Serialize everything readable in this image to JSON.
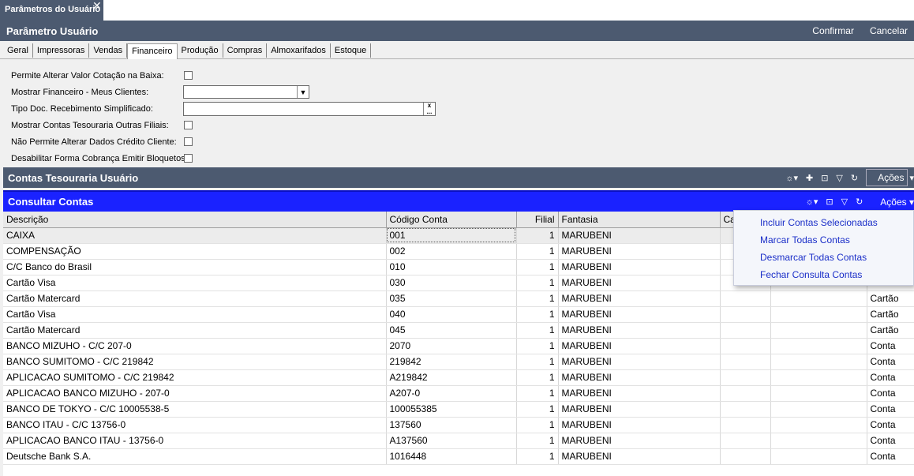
{
  "doc_tab": {
    "title": "Parâmetros do Usuário"
  },
  "header": {
    "title": "Parâmetro Usuário",
    "confirm_label": "Confirmar",
    "cancel_label": "Cancelar"
  },
  "tabs": [
    {
      "label": "Geral"
    },
    {
      "label": "Impressoras"
    },
    {
      "label": "Vendas"
    },
    {
      "label": "Financeiro",
      "active": true
    },
    {
      "label": "Produção"
    },
    {
      "label": "Compras"
    },
    {
      "label": "Almoxarifados"
    },
    {
      "label": "Estoque"
    }
  ],
  "form": {
    "permite_alterar_label": "Permite Alterar Valor Cotação na Baixa:",
    "mostrar_financeiro_label": "Mostrar Financeiro - Meus Clientes:",
    "mostrar_financeiro_value": "",
    "tipo_doc_label": "Tipo Doc. Recebimento Simplificado:",
    "tipo_doc_value": "",
    "mostrar_contas_label": "Mostrar Contas Tesouraria Outras Filiais:",
    "nao_permite_label": "Não Permite Alterar Dados Crédito Cliente:",
    "desabilitar_label": "Desabilitar Forma Cobrança Emitir Bloquetos:"
  },
  "contas_tesouraria": {
    "title": "Contas Tesouraria Usuário",
    "acoes_label": "Ações"
  },
  "consultar_contas": {
    "title": "Consultar Contas",
    "acoes_label": "Ações"
  },
  "grid": {
    "columns": [
      "Descrição",
      "Código Conta",
      "Filial",
      "Fantasia",
      "Ca",
      "",
      ""
    ],
    "rows": [
      [
        "CAIXA",
        "001",
        "1",
        "MARUBENI",
        "",
        "",
        ""
      ],
      [
        "COMPENSAÇÃO",
        "002",
        "1",
        "MARUBENI",
        "",
        "",
        ""
      ],
      [
        "C/C Banco do Brasil",
        "010",
        "1",
        "MARUBENI",
        "",
        "",
        ""
      ],
      [
        "Cartão Visa",
        "030",
        "1",
        "MARUBENI",
        "",
        "",
        ""
      ],
      [
        "Cartão Matercard",
        "035",
        "1",
        "MARUBENI",
        "",
        "",
        "Cartão"
      ],
      [
        "Cartão Visa",
        "040",
        "1",
        "MARUBENI",
        "",
        "",
        "Cartão"
      ],
      [
        "Cartão Matercard",
        "045",
        "1",
        "MARUBENI",
        "",
        "",
        "Cartão"
      ],
      [
        "BANCO MIZUHO - C/C 207-0",
        "2070",
        "1",
        "MARUBENI",
        "",
        "",
        "Conta"
      ],
      [
        "BANCO SUMITOMO - C/C 219842",
        "219842",
        "1",
        "MARUBENI",
        "",
        "",
        "Conta"
      ],
      [
        "APLICACAO SUMITOMO - C/C 219842",
        "A219842",
        "1",
        "MARUBENI",
        "",
        "",
        "Conta"
      ],
      [
        "APLICACAO BANCO MIZUHO - 207-0",
        "A207-0",
        "1",
        "MARUBENI",
        "",
        "",
        "Conta"
      ],
      [
        "BANCO DE TOKYO - C/C 10005538-5",
        "100055385",
        "1",
        "MARUBENI",
        "",
        "",
        "Conta"
      ],
      [
        "BANCO ITAU - C/C 13756-0",
        "137560",
        "1",
        "MARUBENI",
        "",
        "",
        "Conta"
      ],
      [
        "APLICACAO BANCO ITAU - 13756-0",
        "A137560",
        "1",
        "MARUBENI",
        "",
        "",
        "Conta"
      ],
      [
        "Deutsche Bank S.A.",
        "1016448",
        "1",
        "MARUBENI",
        "",
        "",
        "Conta"
      ]
    ]
  },
  "acoes_menu": {
    "items": [
      "Incluir Contas Selecionadas",
      "Marcar Todas Contas",
      "Desmarcar Todas Contas",
      "Fechar Consulta Contas"
    ]
  }
}
